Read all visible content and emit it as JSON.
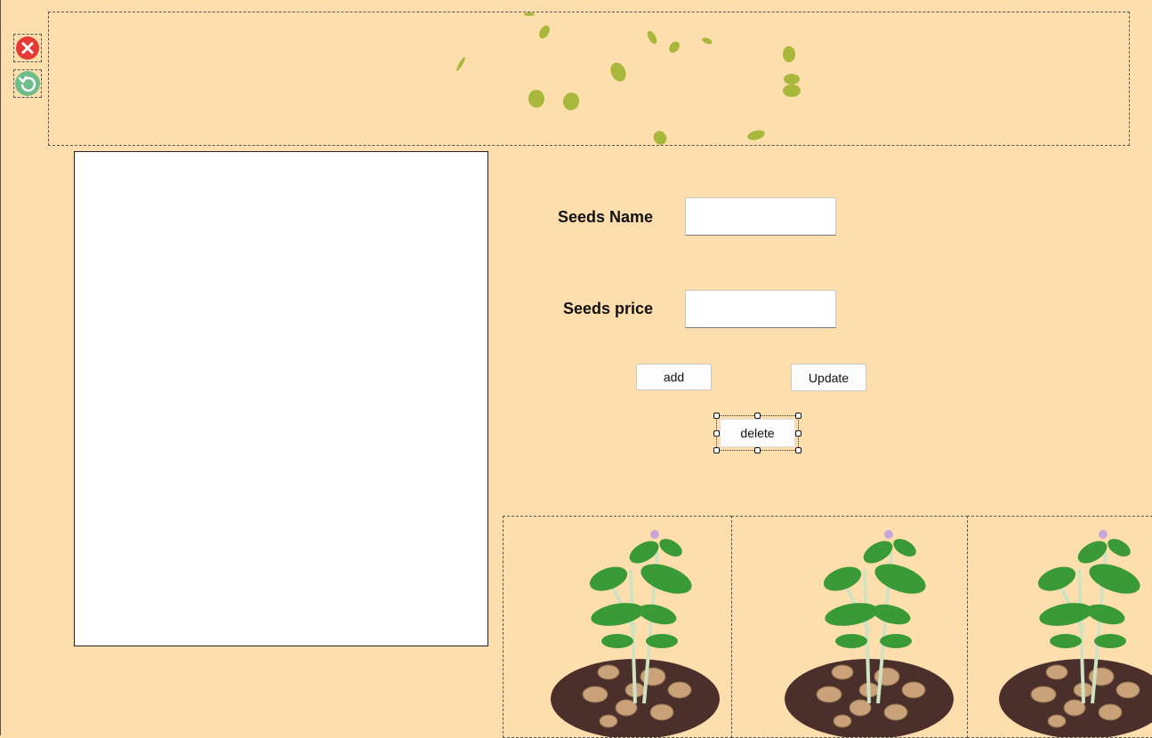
{
  "window": {
    "close_icon": "close-icon",
    "refresh_icon": "refresh-icon"
  },
  "form": {
    "seeds_name_label": "Seeds Name",
    "seeds_name_value": "",
    "seeds_price_label": "Seeds price",
    "seeds_price_value": "",
    "add_label": "add",
    "update_label": "Update",
    "delete_label": "delete"
  },
  "colors": {
    "background": "#fddeac",
    "close": "#e53935",
    "refresh": "#6dbe8b",
    "leaf": "#a8b83a",
    "plant_leaf": "#3a9a36",
    "soil": "#4a2f2a",
    "potato": "#c9a27a"
  }
}
